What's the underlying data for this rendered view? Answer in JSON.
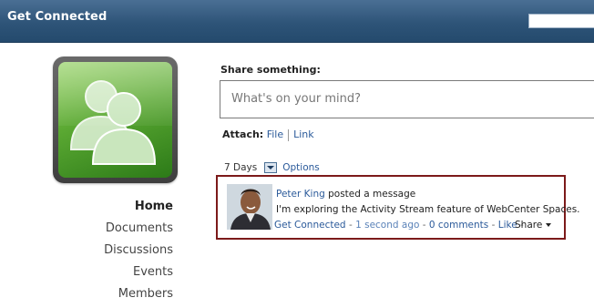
{
  "header": {
    "title": "Get Connected"
  },
  "nav": {
    "items": [
      {
        "label": "Home",
        "active": true
      },
      {
        "label": "Documents"
      },
      {
        "label": "Discussions"
      },
      {
        "label": "Events"
      },
      {
        "label": "Members"
      }
    ]
  },
  "share": {
    "label": "Share something:",
    "placeholder": "What's on your mind?",
    "attach_label": "Attach:",
    "attach_file": "File",
    "attach_link": "Link"
  },
  "filter": {
    "period": "7 Days",
    "options": "Options"
  },
  "activity": {
    "user": "Peter King",
    "action": "posted a message",
    "message": "I'm exploring the Activity Stream feature of WebCenter Spaces.",
    "space": "Get Connected",
    "time": "1 second ago",
    "comments": "0 comments",
    "like": "Like",
    "share": "Share"
  },
  "colors": {
    "header": "#2e5478",
    "link": "#2b5a9a",
    "highlight_border": "#7c1a1a",
    "logo_green": "#5aa832"
  },
  "icons": {
    "logo": "people-group-icon",
    "avatar": "user-avatar-photo",
    "period_dropdown": "chevron-down-icon",
    "share_menu": "caret-down-icon"
  }
}
